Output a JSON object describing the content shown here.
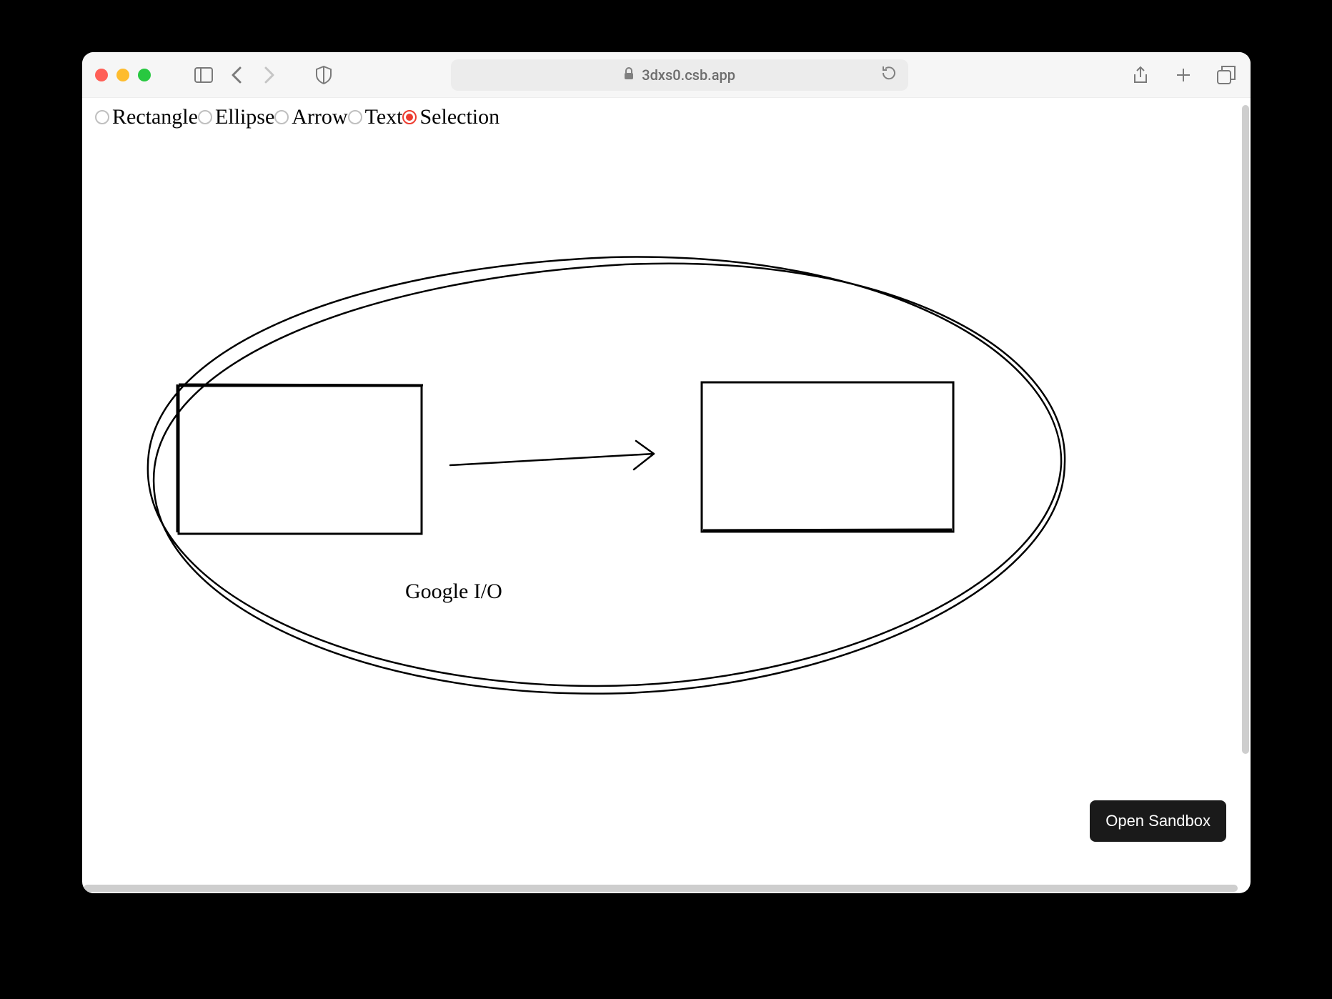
{
  "browser": {
    "url": "3dxs0.csb.app"
  },
  "toolbar": {
    "options": [
      {
        "id": "rectangle",
        "label": "Rectangle",
        "selected": false
      },
      {
        "id": "ellipse",
        "label": "Ellipse",
        "selected": false
      },
      {
        "id": "arrow",
        "label": "Arrow",
        "selected": false
      },
      {
        "id": "text",
        "label": "Text",
        "selected": false
      },
      {
        "id": "selection",
        "label": "Selection",
        "selected": true
      }
    ]
  },
  "canvas": {
    "text_label": "Google I/O"
  },
  "sandbox_button": "Open Sandbox"
}
